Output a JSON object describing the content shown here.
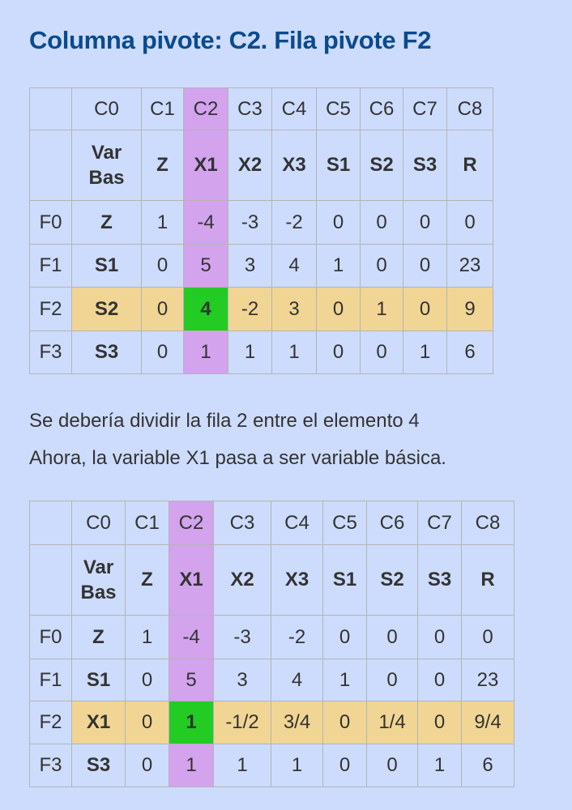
{
  "title": "Columna pivote: C2. Fila pivote F2",
  "paragraph": {
    "line1": "Se debería dividir la fila 2 entre el elemento 4",
    "line2": "Ahora, la variable X1 pasa a ser variable básica."
  },
  "table1": {
    "col_headers": [
      "C0",
      "C1",
      "C2",
      "C3",
      "C4",
      "C5",
      "C6",
      "C7",
      "C8"
    ],
    "var_header": [
      "Var",
      "Bas"
    ],
    "var_row": [
      "Z",
      "X1",
      "X2",
      "X3",
      "S1",
      "S2",
      "S3",
      "R"
    ],
    "rows": [
      {
        "label": "F0",
        "var": "Z",
        "values": [
          "1",
          "-4",
          "-3",
          "-2",
          "0",
          "0",
          "0",
          "0"
        ]
      },
      {
        "label": "F1",
        "var": "S1",
        "values": [
          "0",
          "5",
          "3",
          "4",
          "1",
          "0",
          "0",
          "23"
        ]
      },
      {
        "label": "F2",
        "var": "S2",
        "values": [
          "0",
          "4",
          "-2",
          "3",
          "0",
          "1",
          "0",
          "9"
        ]
      },
      {
        "label": "F3",
        "var": "S3",
        "values": [
          "0",
          "1",
          "1",
          "1",
          "0",
          "0",
          "1",
          "6"
        ]
      }
    ]
  },
  "table2": {
    "col_headers": [
      "C0",
      "C1",
      "C2",
      "C3",
      "C4",
      "C5",
      "C6",
      "C7",
      "C8"
    ],
    "var_header": [
      "Var",
      "Bas"
    ],
    "var_row": [
      "Z",
      "X1",
      "X2",
      "X3",
      "S1",
      "S2",
      "S3",
      "R"
    ],
    "rows": [
      {
        "label": "F0",
        "var": "Z",
        "values": [
          "1",
          "-4",
          "-3",
          "-2",
          "0",
          "0",
          "0",
          "0"
        ]
      },
      {
        "label": "F1",
        "var": "S1",
        "values": [
          "0",
          "5",
          "3",
          "4",
          "1",
          "0",
          "0",
          "23"
        ]
      },
      {
        "label": "F2",
        "var": "X1",
        "values": [
          "0",
          "1",
          "-1/2",
          "3/4",
          "0",
          "1/4",
          "0",
          "9/4"
        ]
      },
      {
        "label": "F3",
        "var": "S3",
        "values": [
          "0",
          "1",
          "1",
          "1",
          "0",
          "0",
          "1",
          "6"
        ]
      }
    ]
  },
  "colors": {
    "background": "#cddcfd",
    "title": "#0b4a8e",
    "pivot_column": "#d3a3ee",
    "pivot_row": "#f1d594",
    "pivot_element": "#22cc22"
  }
}
